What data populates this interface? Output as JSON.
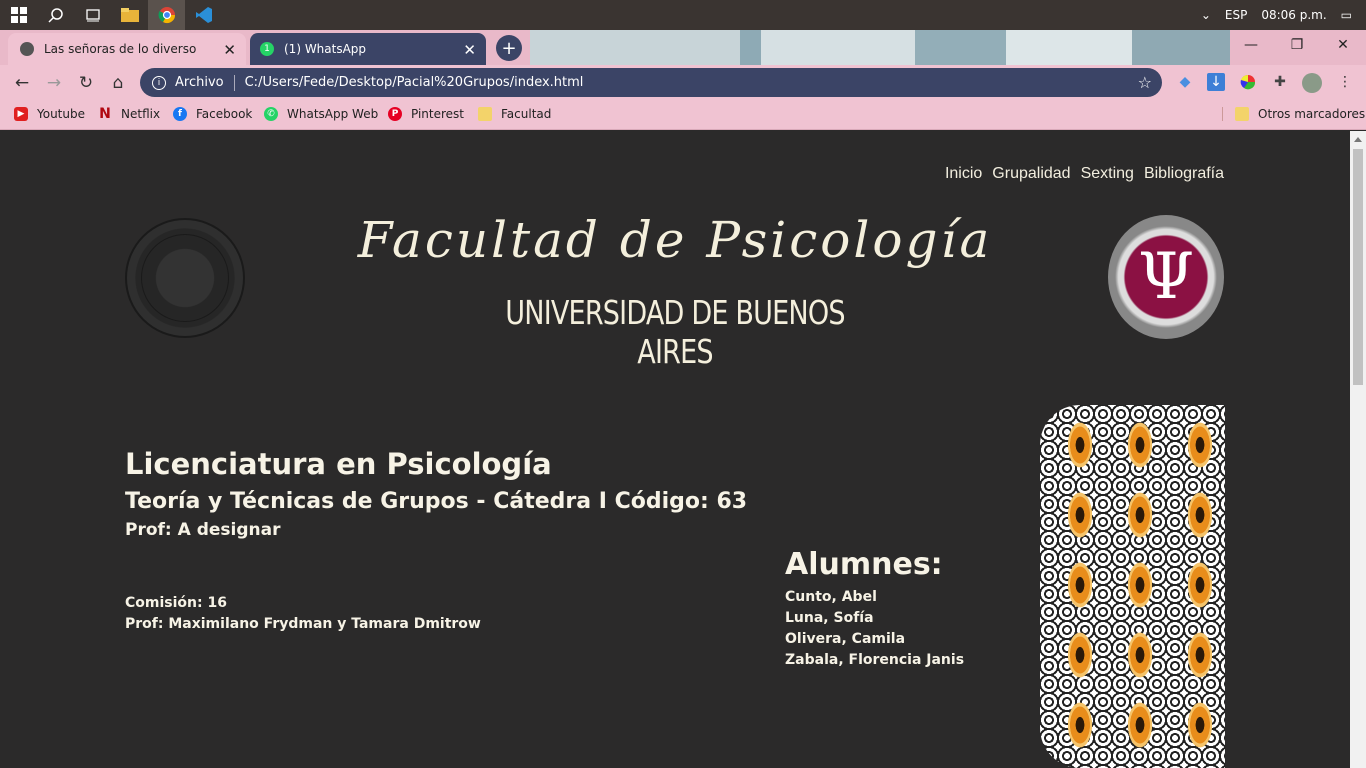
{
  "taskbar": {
    "icons": [
      "windows-icon",
      "search-icon",
      "task-view-icon",
      "file-explorer-icon",
      "chrome-icon",
      "vscode-icon"
    ],
    "language": "ESP",
    "time": "08:06 p.m."
  },
  "browser": {
    "tabs": [
      {
        "title": "Las señoras de lo diverso",
        "active": true
      },
      {
        "title": "(1) WhatsApp",
        "active": false,
        "badge": "1"
      }
    ],
    "address_prefix": "Archivo",
    "url": "C:/Users/Fede/Desktop/Pacial%20Grupos/index.html",
    "bookmarks": [
      {
        "label": "Youtube",
        "icon": "youtube-icon",
        "color": "#e02020"
      },
      {
        "label": "Netflix",
        "icon": "netflix-icon",
        "color": "#b00710"
      },
      {
        "label": "Facebook",
        "icon": "facebook-icon",
        "color": "#1877f2"
      },
      {
        "label": "WhatsApp Web",
        "icon": "whatsapp-icon",
        "color": "#25d366"
      },
      {
        "label": "Pinterest",
        "icon": "pinterest-icon",
        "color": "#e60023"
      },
      {
        "label": "Facultad",
        "icon": "folder-icon",
        "color": "#f3d36a"
      }
    ],
    "other_bookmarks": "Otros marcadores"
  },
  "page": {
    "nav": [
      "Inicio",
      "Grupalidad",
      "Sexting",
      "Bibliografía"
    ],
    "title_script": "Facultad de Psicología",
    "title_uba": "UNIVERSIDAD DE BUENOS AIRES",
    "psi_symbol": "Ψ",
    "career": "Licenciatura en Psicología",
    "subject": "Teoría y Técnicas de Grupos - Cátedra I Código: 63",
    "professor": "Prof: A designar",
    "commission": "Comisión: 16",
    "commission_profs": "Prof: Maximilano Frydman y Tamara Dmitrow",
    "students_title": "Alumnes:",
    "students": [
      "Cunto, Abel",
      "Luna, Sofía",
      "Olivera, Camila",
      "Zabala, Florencia Janis"
    ]
  },
  "colors": {
    "page_bg": "#2b2a2a",
    "text": "#f7f3e6",
    "chrome_pink": "#f0c3d2",
    "omnibox": "#3b4466",
    "psi_logo": "#8b1143"
  }
}
